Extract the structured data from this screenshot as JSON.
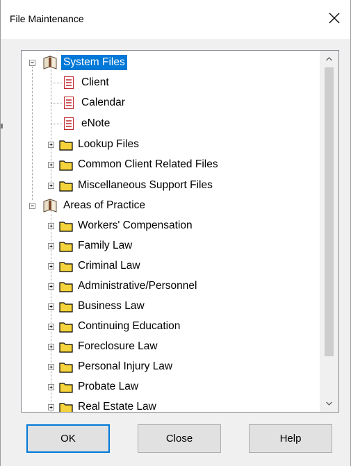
{
  "dialog": {
    "title": "File Maintenance",
    "close_glyph": "×"
  },
  "tree": {
    "system_files": {
      "label": "System Files",
      "icon": "book-icon",
      "children": [
        "Client",
        "Calendar",
        "eNote"
      ]
    },
    "system_folders": [
      "Lookup Files",
      "Common Client Related Files",
      "Miscellaneous Support Files"
    ],
    "areas_of_practice": {
      "label": "Areas of Practice",
      "icon": "book-icon",
      "children": [
        "Workers' Compensation",
        "Family Law",
        "Criminal Law",
        "Administrative/Personnel",
        "Business Law",
        "Continuing Education",
        "Foreclosure Law",
        "Personal Injury Law",
        "Probate Law",
        "Real Estate Law"
      ]
    }
  },
  "buttons": {
    "ok": "OK",
    "close": "Close",
    "help": "Help"
  },
  "colors": {
    "selection": "#0078d7",
    "folder": "#f5d33a",
    "doc": "#c0262d"
  }
}
